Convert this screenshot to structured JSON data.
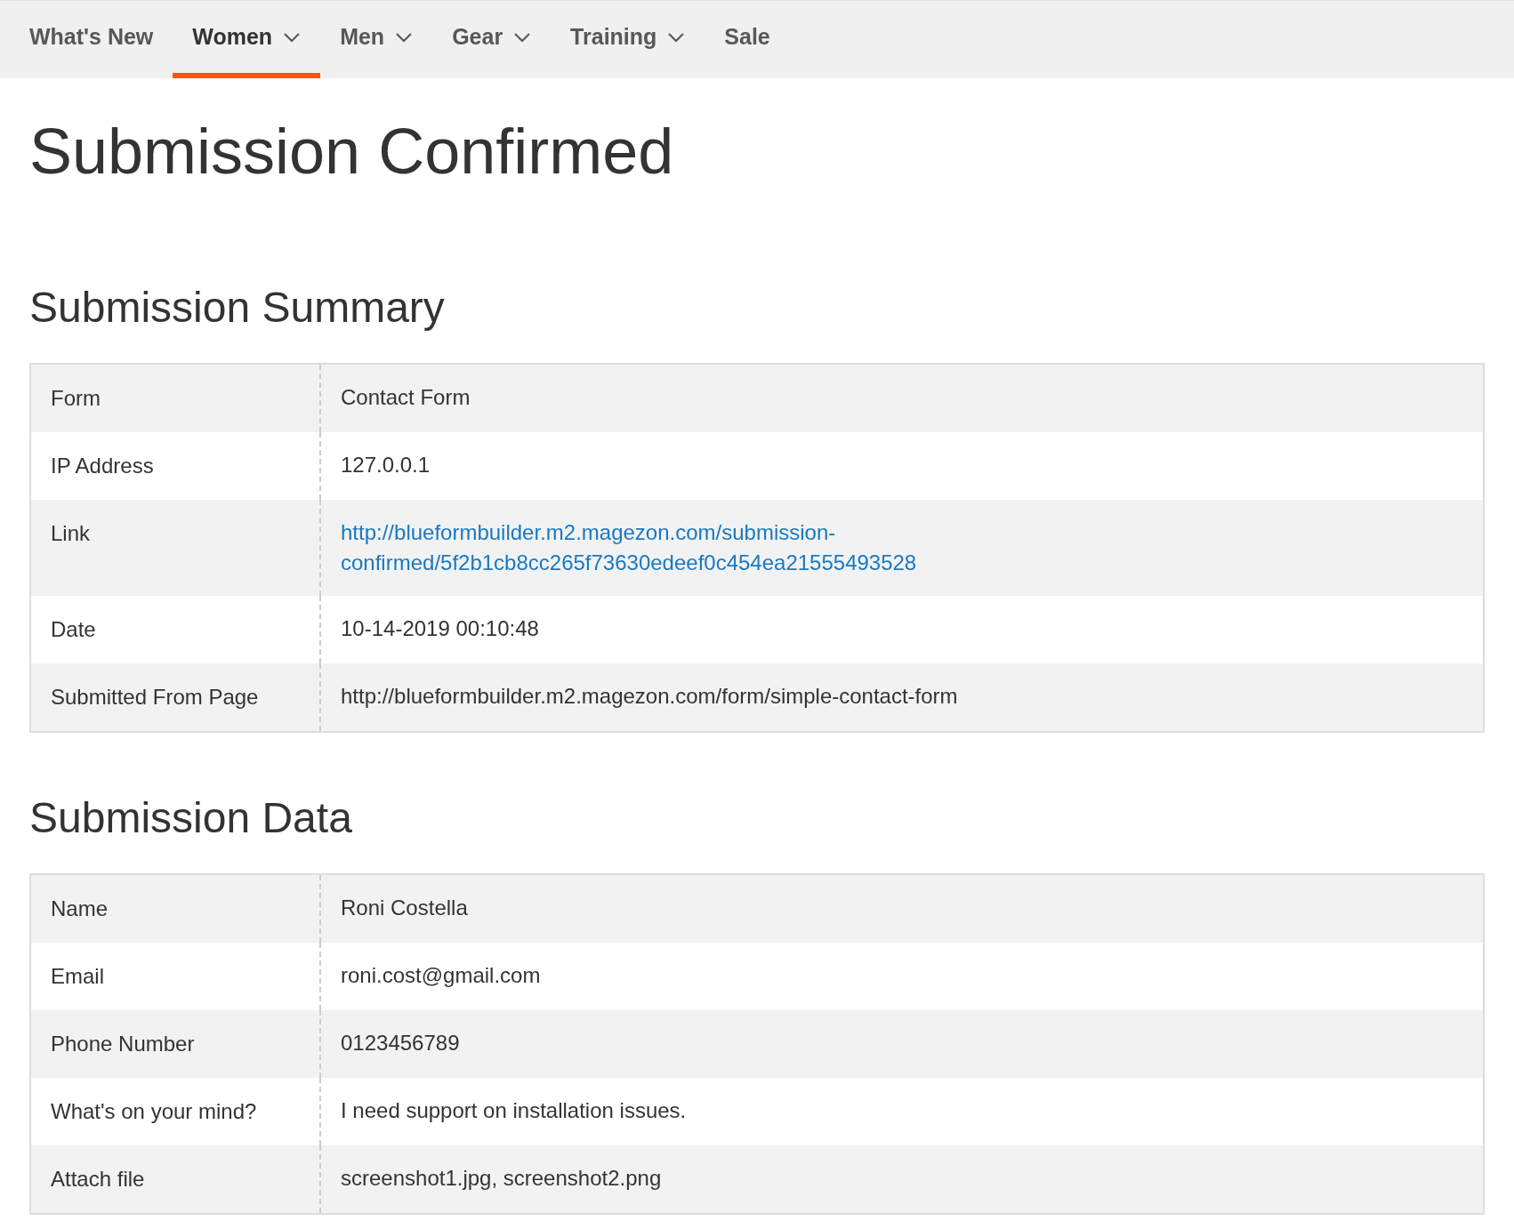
{
  "nav": [
    {
      "label": "What's New",
      "selected": false,
      "dropdown": false
    },
    {
      "label": "Women",
      "selected": true,
      "dropdown": true
    },
    {
      "label": "Men",
      "selected": false,
      "dropdown": true
    },
    {
      "label": "Gear",
      "selected": false,
      "dropdown": true
    },
    {
      "label": "Training",
      "selected": false,
      "dropdown": true
    },
    {
      "label": "Sale",
      "selected": false,
      "dropdown": false
    }
  ],
  "title": "Submission Confirmed",
  "sections": [
    {
      "heading": "Submission Summary",
      "rows": [
        {
          "label": "Form",
          "value": "Contact Form",
          "kind": "text"
        },
        {
          "label": "IP Address",
          "value": "127.0.0.1",
          "kind": "text"
        },
        {
          "label": "Link",
          "value": "http://blueformbuilder.m2.magezon.com/submission-confirmed/5f2b1cb8cc265f73630edeef0c454ea21555493528",
          "kind": "link"
        },
        {
          "label": "Date",
          "value": "10-14-2019 00:10:48",
          "kind": "text"
        },
        {
          "label": "Submitted From Page",
          "value": "http://blueformbuilder.m2.magezon.com/form/simple-contact-form",
          "kind": "text"
        }
      ]
    },
    {
      "heading": "Submission Data",
      "rows": [
        {
          "label": "Name",
          "value": "Roni Costella",
          "kind": "text"
        },
        {
          "label": "Email",
          "value": "roni.cost@gmail.com",
          "kind": "text"
        },
        {
          "label": "Phone Number",
          "value": "0123456789",
          "kind": "text"
        },
        {
          "label": "What's on your mind?",
          "value": "I need support on installation issues.",
          "kind": "text"
        },
        {
          "label": "Attach file",
          "value": "screenshot1.jpg, screenshot2.png",
          "kind": "text"
        }
      ]
    }
  ]
}
